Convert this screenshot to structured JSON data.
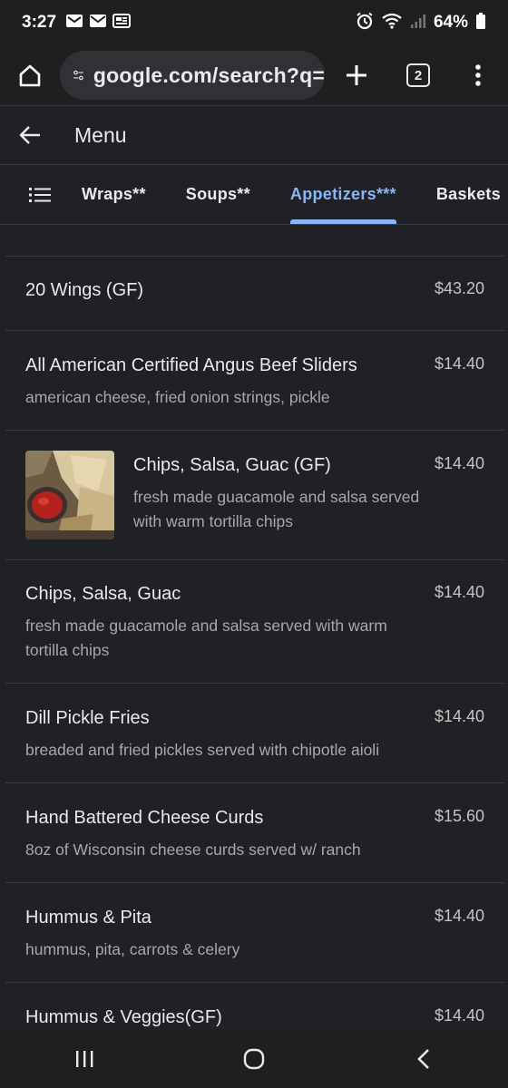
{
  "status": {
    "time": "3:27",
    "battery": "64%"
  },
  "browser": {
    "url": "google.com/search?q=",
    "tab_count": "2"
  },
  "header": {
    "title": "Menu"
  },
  "categories": {
    "tabs": [
      "Wraps**",
      "Soups**",
      "Appetizers***",
      "Baskets"
    ],
    "active": "Appetizers***"
  },
  "menu": {
    "items": [
      {
        "name": "20 Wings (GF)",
        "price": "$43.20",
        "description": ""
      },
      {
        "name": "All American Certified Angus Beef Sliders",
        "price": "$14.40",
        "description": "american cheese, fried onion strings, pickle"
      },
      {
        "name": "Chips, Salsa, Guac (GF)",
        "price": "$14.40",
        "description_lines": [
          "fresh made guacamole and salsa served",
          "with warm tortilla chips"
        ]
      },
      {
        "name": "Chips, Salsa, Guac",
        "price": "$14.40",
        "description_lines": [
          "fresh made guacamole and salsa served with warm",
          "tortilla chips"
        ]
      },
      {
        "name": "Dill Pickle Fries",
        "price": "$14.40",
        "description": "breaded and fried pickles served with chipotle aioli"
      },
      {
        "name": "Hand Battered Cheese Curds",
        "price": "$15.60",
        "description": "8oz of Wisconsin cheese curds served w/ ranch"
      },
      {
        "name": "Hummus & Pita",
        "price": "$14.40",
        "description": "hummus, pita, carrots & celery"
      },
      {
        "name": "Hummus & Veggies(GF)",
        "price": "$14.40",
        "description": ""
      }
    ]
  },
  "colors": {
    "accent": "#8ab4f8",
    "background": "#202124"
  }
}
